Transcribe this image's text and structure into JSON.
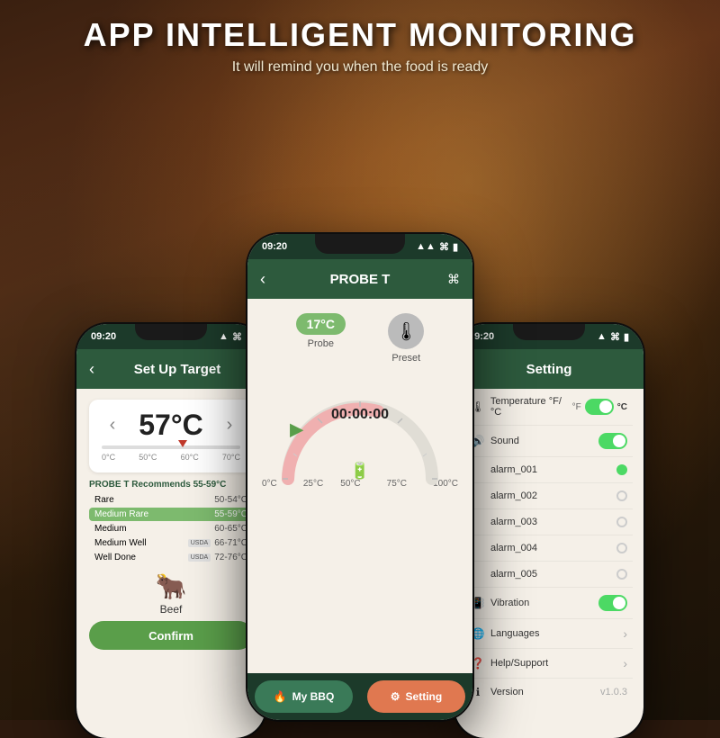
{
  "header": {
    "main_title": "APP INTELLIGENT MONITORING",
    "sub_title": "It will remind you when the food is ready"
  },
  "left_phone": {
    "status_time": "09:20",
    "nav_title": "Set Up Target",
    "temp_value": "57°C",
    "temp_left_arrow": "‹",
    "temp_right_arrow": "›",
    "scale_labels": [
      "0°C",
      "50°C",
      "60°C",
      "70°C"
    ],
    "probe_section_label": "PROBE T",
    "probe_recommends": "Recommends",
    "probe_range": "55-59°C",
    "meat_options": [
      {
        "name": "Rare",
        "range": "50-54°C",
        "highlight": false,
        "usda": false
      },
      {
        "name": "Medium Rare",
        "range": "55-59°C",
        "highlight": true,
        "usda": false
      },
      {
        "name": "Medium",
        "range": "60-65°C",
        "highlight": false,
        "usda": false
      },
      {
        "name": "Medium Well",
        "range": "66-71°C",
        "highlight": false,
        "usda": true
      },
      {
        "name": "Well Done",
        "range": "72-76°C",
        "highlight": false,
        "usda": true
      }
    ],
    "beef_label": "Beef",
    "confirm_label": "Confirm"
  },
  "center_phone": {
    "status_time": "09:20",
    "nav_title": "PROBE T",
    "probe_temp": "17°C",
    "probe_label": "Probe",
    "preset_label": "Preset",
    "timer": "00:00:00",
    "gauge_labels": [
      "0°C",
      "25°C",
      "50°C",
      "75°C",
      "100°C"
    ],
    "bottom_tabs": [
      {
        "label": "My BBQ",
        "active": false
      },
      {
        "label": "Setting",
        "active": true
      }
    ]
  },
  "right_phone": {
    "status_time": "09:20",
    "nav_title": "Setting",
    "settings": [
      {
        "icon": "🌡",
        "label": "Temperature °F/°C",
        "type": "toggle_labels",
        "left_label": "°F",
        "right_label": "°C",
        "value": true
      },
      {
        "icon": "🔊",
        "label": "Sound",
        "type": "toggle",
        "value": true
      },
      {
        "icon": "",
        "label": "alarm_001",
        "type": "radio",
        "selected": true
      },
      {
        "icon": "",
        "label": "alarm_002",
        "type": "radio",
        "selected": false
      },
      {
        "icon": "",
        "label": "alarm_003",
        "type": "radio",
        "selected": false
      },
      {
        "icon": "",
        "label": "alarm_004",
        "type": "radio",
        "selected": false
      },
      {
        "icon": "",
        "label": "alarm_005",
        "type": "radio",
        "selected": false
      },
      {
        "icon": "📳",
        "label": "Vibration",
        "type": "toggle",
        "value": true
      },
      {
        "icon": "🌐",
        "label": "Languages",
        "type": "chevron"
      },
      {
        "icon": "❓",
        "label": "Help/Support",
        "type": "chevron"
      },
      {
        "icon": "ℹ",
        "label": "Version",
        "type": "value",
        "value": "v1.0.3"
      }
    ]
  }
}
